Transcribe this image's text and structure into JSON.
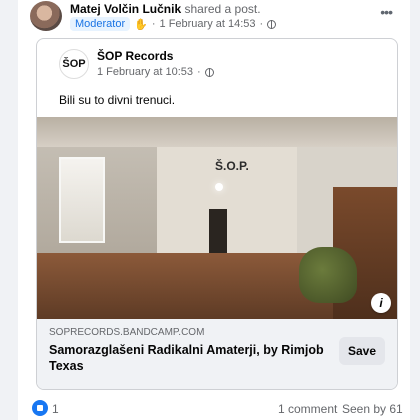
{
  "header": {
    "author": "Matej Volčin Lučnik",
    "action": "shared a post.",
    "badge": "Moderator",
    "timestamp": "1 February at 14:53",
    "more_icon": "more-dots-icon"
  },
  "shared_post": {
    "page_name": "ŠOP Records",
    "logo_text": "ŠOP",
    "timestamp": "1 February at 10:53",
    "text": "Bili su to divni trenuci.",
    "photo_text": "Š.O.P.",
    "link": {
      "domain": "SOPRECORDS.BANDCAMP.COM",
      "title": "Samorazglašeni Radikalni Amaterji, by Rimjob Texas",
      "save_label": "Save"
    }
  },
  "footer": {
    "likes": "1",
    "comments": "1 comment",
    "seen": "Seen by 61"
  },
  "colors": {
    "accent": "#1877f2",
    "badge_bg": "#e7f3ff",
    "badge_text": "#1b74e4"
  }
}
